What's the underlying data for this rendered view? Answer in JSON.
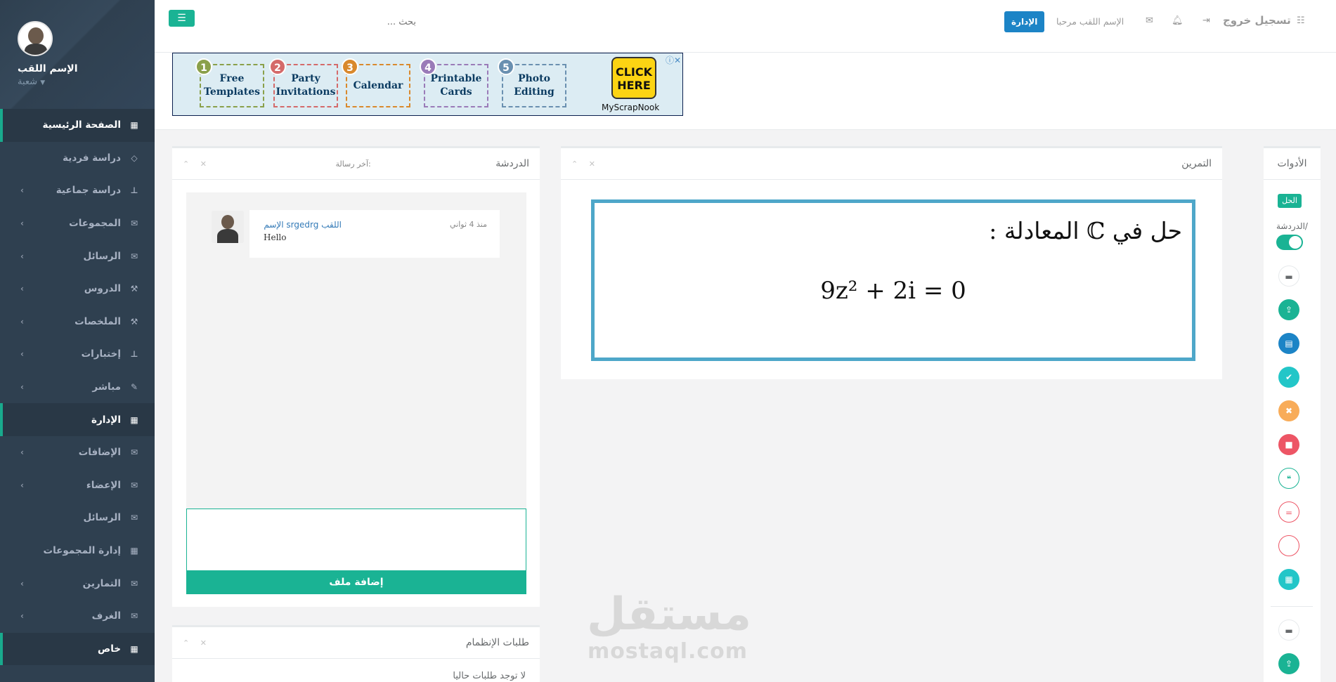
{
  "sidebar": {
    "profile_name": "الإسم اللقب",
    "profile_role": "شعبة",
    "items": [
      {
        "label": "الصفحة الرئيسية",
        "icon": "th-large-icon"
      },
      {
        "label": "دراسة فردية",
        "icon": "diamond-icon"
      },
      {
        "label": "دراسة جماعية",
        "icon": "sitemap-icon"
      },
      {
        "label": "المجموعات",
        "icon": "envelope-icon"
      },
      {
        "label": "الرسائل",
        "icon": "envelope-icon"
      },
      {
        "label": "الدروس",
        "icon": "wrench-icon"
      },
      {
        "label": "الملخصات",
        "icon": "wrench-icon"
      },
      {
        "label": "إختبارات",
        "icon": "sitemap-icon"
      },
      {
        "label": "مباشر",
        "icon": "edit-icon"
      },
      {
        "label": "الإدارة",
        "icon": "th-large-icon"
      },
      {
        "label": "الإضافات",
        "icon": "envelope-icon"
      },
      {
        "label": "الإعضاء",
        "icon": "envelope-icon"
      },
      {
        "label": "الرسائل",
        "icon": "envelope-icon"
      },
      {
        "label": "إدارة المجموعات",
        "icon": "th-large-icon"
      },
      {
        "label": "التمارين",
        "icon": "envelope-icon"
      },
      {
        "label": "الغرف",
        "icon": "envelope-icon"
      },
      {
        "label": "خاص",
        "icon": "th-large-icon"
      }
    ]
  },
  "topbar": {
    "search_placeholder": "بحث ...",
    "admin_label": "الإدارة",
    "welcome": "الإسم اللقب مرحبا",
    "logout": "تسجيل خروج"
  },
  "ad": {
    "cards": [
      "Free Templates",
      "Party Invitations",
      "Calendar",
      "Printable Cards",
      "Photo Editing"
    ],
    "numbers": [
      "1",
      "2",
      "3",
      "4",
      "5"
    ],
    "click": "CLICK HERE",
    "brand": "MyScrapNook"
  },
  "tools": {
    "title": "الأدوات",
    "solution_label": "الحل",
    "chat_label": "الدردشة/"
  },
  "exercise": {
    "title": "التمرين",
    "question": "حل في ℂ المعادلة :",
    "equation": "9z² + 2i = 0"
  },
  "chat": {
    "title": "الدردشة",
    "last_message_label": "آخر رسالة:",
    "message": {
      "author": "الإسم srgedrg اللقب",
      "time": "منذ 4 ثواني",
      "text": "Hello"
    },
    "add_file": "إضافة ملف"
  },
  "join": {
    "title": "طلبات الإنظمام",
    "empty": "لا توجد طلبات حاليا"
  },
  "watermark": {
    "arabic": "مستقل",
    "latin": "mostaql.com"
  },
  "colors": {
    "accent": "#1ab394",
    "sidebar": "#2f4050",
    "primary": "#1c84c6",
    "exercise_border": "#4ea7c9"
  }
}
